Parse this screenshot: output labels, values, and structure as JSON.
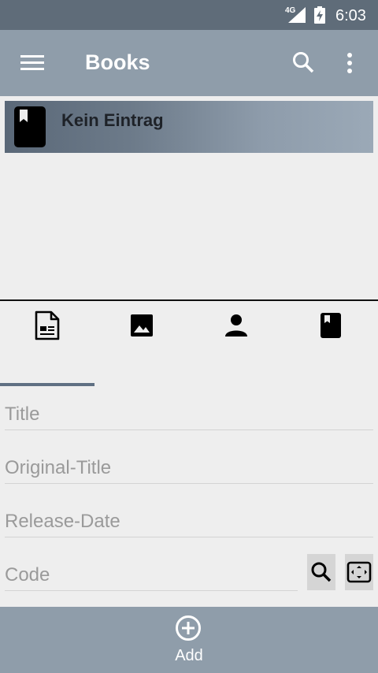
{
  "status_bar": {
    "network": "4G",
    "time": "6:03"
  },
  "app_bar": {
    "title": "Books"
  },
  "list": {
    "items": [
      {
        "label": "Kein Eintrag"
      }
    ]
  },
  "form": {
    "title_placeholder": "Title",
    "original_title_placeholder": "Original-Title",
    "release_date_placeholder": "Release-Date",
    "code_placeholder": "Code"
  },
  "bottom_bar": {
    "add_label": "Add"
  },
  "colors": {
    "status_bar": "#5f6c79",
    "app_bar": "#8f9daa",
    "tab_indicator": "#5f6f82",
    "background": "#eeeeee"
  }
}
